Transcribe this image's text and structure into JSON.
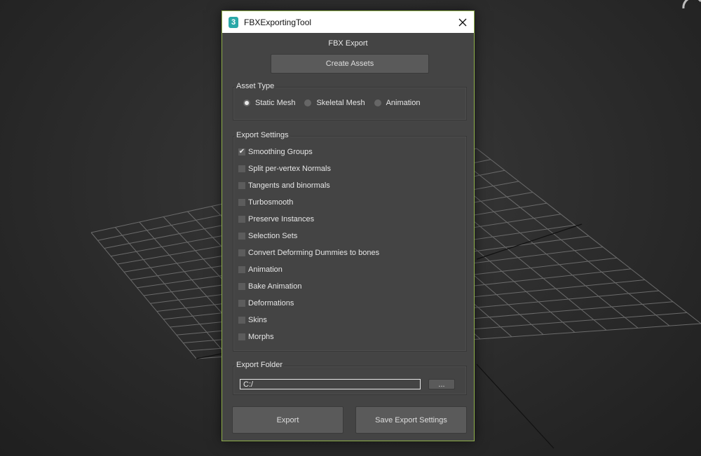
{
  "window": {
    "app_icon_glyph": "3",
    "title": "FBXExportingTool",
    "close_glyph": "✕"
  },
  "heading": "FBX Export",
  "create_assets_label": "Create Assets",
  "asset_type": {
    "label": "Asset Type",
    "options": [
      "Static Mesh",
      "Skeletal Mesh",
      "Animation"
    ],
    "selected": "Static Mesh"
  },
  "export_settings": {
    "label": "Export Settings",
    "items": [
      {
        "label": "Smoothing Groups",
        "checked": true
      },
      {
        "label": "Split per-vertex Normals",
        "checked": false
      },
      {
        "label": "Tangents and binormals",
        "checked": false
      },
      {
        "label": "Turbosmooth",
        "checked": false
      },
      {
        "label": "Preserve Instances",
        "checked": false
      },
      {
        "label": "Selection Sets",
        "checked": false
      },
      {
        "label": "Convert Deforming Dummies to bones",
        "checked": false
      },
      {
        "label": "Animation",
        "checked": false
      },
      {
        "label": "Bake Animation",
        "checked": false
      },
      {
        "label": "Deformations",
        "checked": false
      },
      {
        "label": "Skins",
        "checked": false
      },
      {
        "label": "Morphs",
        "checked": false
      }
    ]
  },
  "export_folder": {
    "label": "Export Folder",
    "value": "C:/",
    "browse_label": "..."
  },
  "footer": {
    "export_label": "Export",
    "save_label": "Save Export Settings"
  },
  "colors": {
    "dialog_bg": "#444444",
    "border_accent": "#8fb04a",
    "titlebar_bg": "#ffffff",
    "app_icon": "#2aa8a8"
  }
}
